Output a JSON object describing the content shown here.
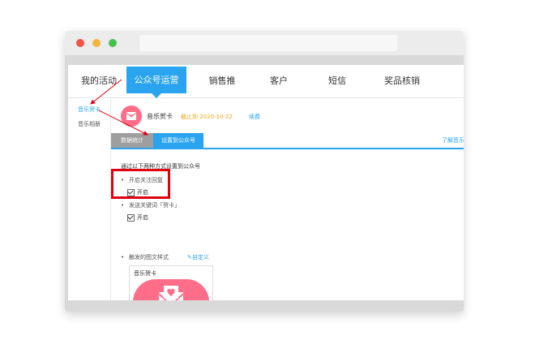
{
  "nav": {
    "items": [
      {
        "label": "我的活动",
        "active": false
      },
      {
        "label": "公众号运营",
        "active": true
      },
      {
        "label": "销售推",
        "active": false
      },
      {
        "label": "客户",
        "active": false
      },
      {
        "label": "短信",
        "active": false
      },
      {
        "label": "奖品核销",
        "active": false
      }
    ]
  },
  "sidebar": {
    "items": [
      {
        "label": "音乐贺卡",
        "active": true
      },
      {
        "label": "音乐相册",
        "active": false
      }
    ]
  },
  "card": {
    "title": "音乐贺卡",
    "deadline": "截止到 2020-10-22",
    "renew_label": "续费",
    "icon": "heart-envelope-icon"
  },
  "tabs": [
    {
      "label": "数据统计",
      "active": false
    },
    {
      "label": "设置到公众号",
      "active": true
    }
  ],
  "learn_more": "了解音乐",
  "instructions": "通过以下两种方式设置到公众号",
  "options": [
    {
      "label": "开启关注回复",
      "checkbox_label": "开启",
      "checked": true
    },
    {
      "label": "发送关键词「贺卡」",
      "checkbox_label": "开启",
      "checked": true
    }
  ],
  "style_section": {
    "label": "触发的图文样式",
    "customize_label": "自定义"
  },
  "preview": {
    "title": "音乐贺卡"
  },
  "colors": {
    "accent": "#2aa4ee",
    "highlight": "#e00010",
    "pink": "#ff6d88",
    "deadline": "#f5a623"
  }
}
